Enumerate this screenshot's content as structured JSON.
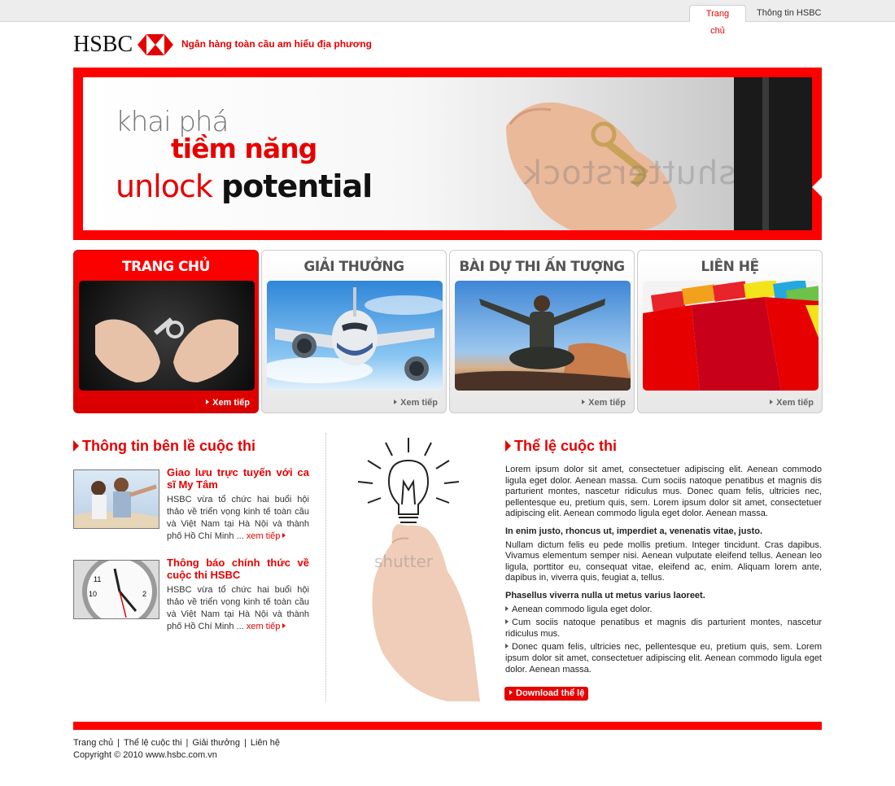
{
  "topnav": {
    "home": "Trang chủ",
    "info": "Thông tin HSBC"
  },
  "brand": {
    "logo": "HSBC",
    "tagline": "Ngân hàng toàn cầu am hiểu địa phương",
    "color": "#e60000"
  },
  "banner": {
    "line1": "khai phá",
    "line2": "tiềm năng",
    "line3a": "unlock",
    "line3b": "potential",
    "watermark": "shutterstock"
  },
  "nav_cards": [
    {
      "title": "TRANG CHỦ",
      "more": "Xem tiếp"
    },
    {
      "title": "GIẢI THƯỞNG",
      "more": "Xem tiếp"
    },
    {
      "title": "BÀI DỰ THI ẤN TƯỢNG",
      "more": "Xem tiếp"
    },
    {
      "title": "LIÊN HỆ",
      "more": "Xem tiếp"
    }
  ],
  "sidebar": {
    "title": "Thông tin bên lề cuộc thi",
    "news": [
      {
        "title": "Giao lưu trực tuyến với ca sĩ My Tâm",
        "text": "HSBC vừa tổ chức hai buổi hội thảo về triển vọng kinh tế toàn cầu và Việt Nam tại Hà Nội và thành phố Hồ Chí Minh ...",
        "more": "xem tiếp"
      },
      {
        "title": "Thông báo chính thức về cuộc thi HSBC",
        "text": "HSBC vừa tổ chức hai buổi hội thảo về triển vọng kinh tế toàn cầu và Việt Nam tại Hà Nội và thành phố Hồ Chí Minh ...",
        "more": "xem tiếp"
      }
    ]
  },
  "middle_image": {
    "watermark": "shutter"
  },
  "rules": {
    "title": "Thể lệ cuộc thi",
    "para1": "Lorem ipsum dolor sit amet, consectetuer adipiscing elit. Aenean commodo ligula eget dolor. Aenean massa. Cum sociis natoque penatibus et magnis dis parturient montes, nascetur ridiculus mus. Donec quam felis, ultricies nec, pellentesque eu, pretium quis, sem. Lorem ipsum dolor sit amet, consectetuer adipiscing elit. Aenean commodo ligula eget dolor. Aenean massa.",
    "heading2": "In enim justo, rhoncus ut, imperdiet a, venenatis vitae, justo.",
    "para2": "Nullam dictum felis eu pede mollis pretium. Integer tincidunt. Cras dapibus. Vivamus elementum semper nisi. Aenean vulputate eleifend tellus. Aenean leo ligula, porttitor eu, consequat vitae, eleifend ac, enim. Aliquam lorem ante, dapibus in, viverra quis, feugiat a, tellus.",
    "heading3": "Phasellus viverra nulla ut metus varius laoreet.",
    "bullets": [
      "Aenean commodo ligula eget dolor.",
      "Cum sociis natoque penatibus et magnis dis parturient montes, nascetur ridiculus mus.",
      "Donec quam felis, ultricies nec, pellentesque eu, pretium quis, sem. Lorem ipsum dolor sit amet, consectetuer adipiscing elit. Aenean commodo ligula eget dolor. Aenean massa."
    ],
    "download": "Download thể lệ"
  },
  "footer": {
    "links": [
      "Trang chủ",
      "Thể lệ cuộc thi",
      "Giải thưởng",
      "Liên hệ"
    ],
    "copyright": "Copyright © 2010 www.hsbc.com.vn"
  }
}
